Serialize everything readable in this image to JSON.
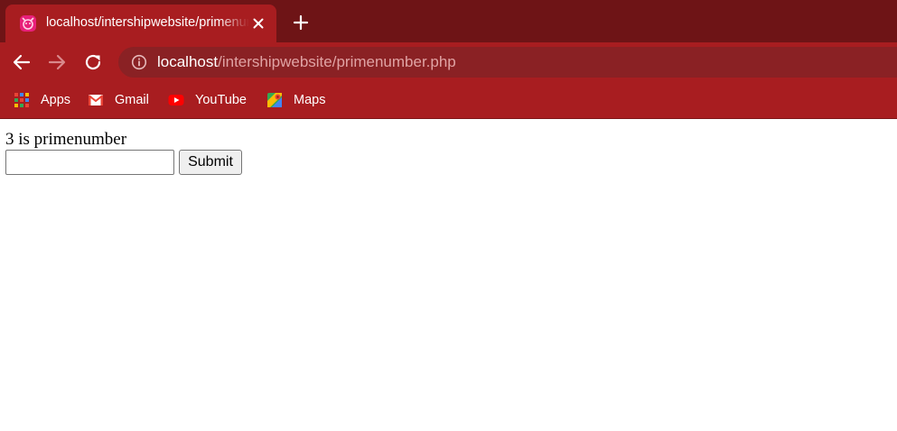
{
  "browser": {
    "tab": {
      "title": "localhost/intershipwebsite/primenumber.php",
      "favicon": "site-favicon-icon",
      "close_icon": "close-icon"
    },
    "new_tab_icon": "plus-icon",
    "nav": {
      "back_icon": "arrow-left-icon",
      "forward_icon": "arrow-right-icon",
      "reload_icon": "reload-icon"
    },
    "omnibox": {
      "info_icon": "info-icon",
      "url_host": "localhost",
      "url_path": "/intershipwebsite/primenumber.php"
    },
    "bookmarks": [
      {
        "label": "Apps",
        "icon": "apps-grid-icon"
      },
      {
        "label": "Gmail",
        "icon": "gmail-icon"
      },
      {
        "label": "YouTube",
        "icon": "youtube-icon"
      },
      {
        "label": "Maps",
        "icon": "maps-icon"
      }
    ],
    "colors": {
      "tabstrip": "#6e1416",
      "toolbar": "#a81d20",
      "omnibox": "#8a2124"
    }
  },
  "page": {
    "result_text": "3 is primenumber",
    "number_input": {
      "value": "",
      "placeholder": ""
    },
    "submit_label": "Submit"
  }
}
